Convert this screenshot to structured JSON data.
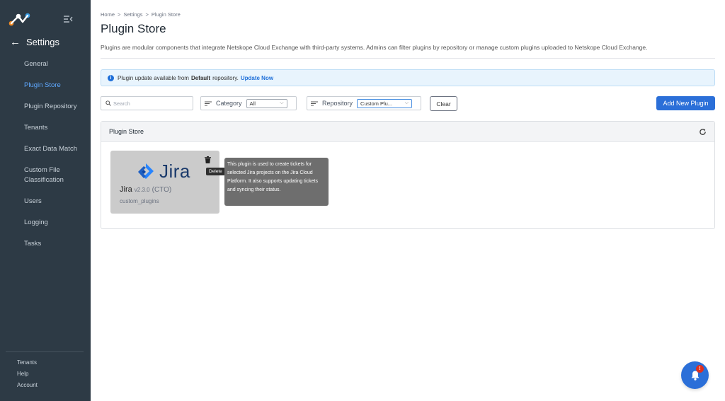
{
  "sidebar": {
    "back_label": "Settings",
    "items": [
      {
        "label": "General",
        "active": false
      },
      {
        "label": "Plugin Store",
        "active": true
      },
      {
        "label": "Plugin Repository",
        "active": false
      },
      {
        "label": "Tenants",
        "active": false
      },
      {
        "label": "Exact Data Match",
        "active": false
      },
      {
        "label": "Custom File Classification",
        "active": false
      },
      {
        "label": "Users",
        "active": false
      },
      {
        "label": "Logging",
        "active": false
      },
      {
        "label": "Tasks",
        "active": false
      }
    ],
    "bottom_links": [
      "Tenants",
      "Help",
      "Account"
    ]
  },
  "breadcrumb": [
    "Home",
    "Settings",
    "Plugin Store"
  ],
  "breadcrumb_sep": ">",
  "page": {
    "title": "Plugin Store",
    "description": "Plugins are modular components that integrate Netskope Cloud Exchange with third-party systems. Admins can filter plugins by repository or manage custom plugins uploaded to Netskope Cloud Exchange."
  },
  "alert": {
    "prefix": "Plugin update available from",
    "repo": "Default",
    "suffix": "repository.",
    "link": "Update Now"
  },
  "toolbar": {
    "search_placeholder": "Search",
    "category_label": "Category",
    "category_value": "All",
    "repository_label": "Repository",
    "repository_value": "Custom Plu...",
    "clear_label": "Clear",
    "add_label": "Add New Plugin"
  },
  "panel": {
    "title": "Plugin Store"
  },
  "plugin_card": {
    "logo_text": "Jira",
    "name": "Jira",
    "version": "v2.3.0",
    "tag": "(CTO)",
    "repository": "custom_plugins"
  },
  "tooltips": {
    "delete": "Delete",
    "description": "This plugin is used to create tickets for selected Jira projects on the Jira Cloud Platform. It also supports updating tickets and syncing their status."
  },
  "notifications": {
    "badge": "!"
  },
  "colors": {
    "sidebar_bg": "#2d3a45",
    "accent": "#2b6fd8",
    "active_nav": "#5fa8ff",
    "badge": "#e0301e"
  }
}
